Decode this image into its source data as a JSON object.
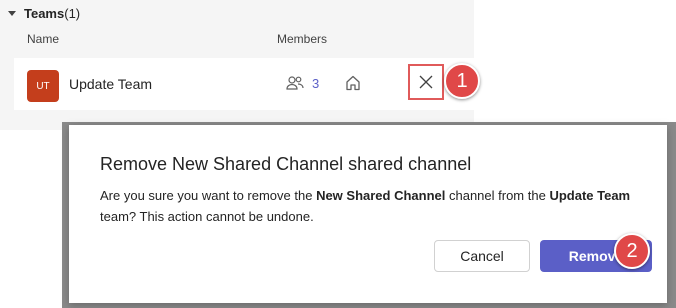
{
  "teams": {
    "title": "Teams",
    "count": "(1)",
    "columns": {
      "name": "Name",
      "members": "Members"
    },
    "row": {
      "initials": "UT",
      "name": "Update Team",
      "member_count": "3"
    }
  },
  "dialog": {
    "title": "Remove New Shared Channel shared channel",
    "body": {
      "part1": "Are you sure you want to remove the ",
      "channel": "New Shared Channel",
      "part2": " channel from the ",
      "team": "Update Team",
      "part3": " team? This action cannot be undone."
    },
    "cancel_label": "Cancel",
    "remove_label": "Remove"
  },
  "callouts": {
    "first": "1",
    "second": "2"
  },
  "colors": {
    "accent": "#5b5fc7",
    "avatar": "#c43e1c",
    "callout": "#e04848",
    "highlight_border": "#e05a5a"
  },
  "icons": [
    "caret-down-icon",
    "people-icon",
    "home-icon",
    "close-icon"
  ]
}
